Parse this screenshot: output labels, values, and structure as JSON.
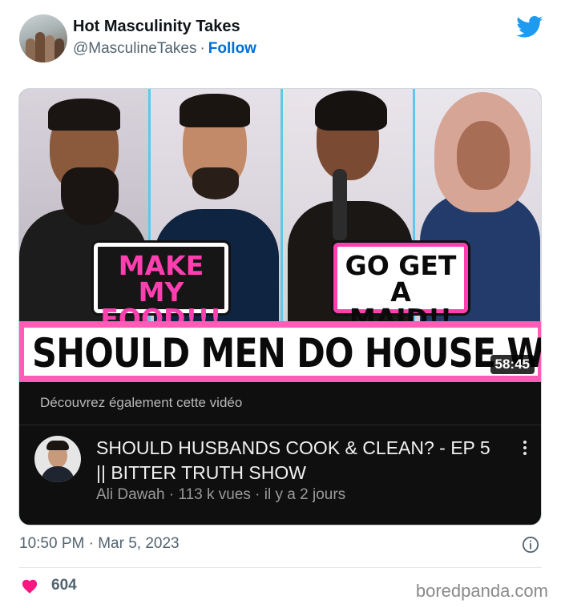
{
  "tweet": {
    "author_name": "Hot Masculinity Takes",
    "handle": "@MasculineTakes",
    "separator": "·",
    "follow_label": "Follow",
    "timestamp": "10:50 PM · Mar 5, 2023",
    "like_count": "604"
  },
  "thumbnail": {
    "bubble_left": "MAKE MY\nFOOD!!!",
    "bubble_right": "GO GET\nA MAID!!",
    "banner_text": "SHOULD MEN DO HOUSE WORK?",
    "duration": "58:45"
  },
  "related": {
    "label": "Découvrez également cette vidéo",
    "title": "SHOULD HUSBANDS COOK & CLEAN? - EP 5 || BITTER TRUTH SHOW",
    "meta": "Ali Dawah · 113 k vues · il y a 2 jours"
  },
  "watermark": "boredpanda.com",
  "colors": {
    "twitter_blue": "#1d9bf0",
    "follow_blue": "#006fd6",
    "heart": "#f91880",
    "banner_pink": "#ff5cb8",
    "panel_divider": "#5ec7f0"
  },
  "icons": [
    "twitter-bird-icon",
    "info-icon",
    "heart-icon",
    "more-vertical-icon"
  ]
}
